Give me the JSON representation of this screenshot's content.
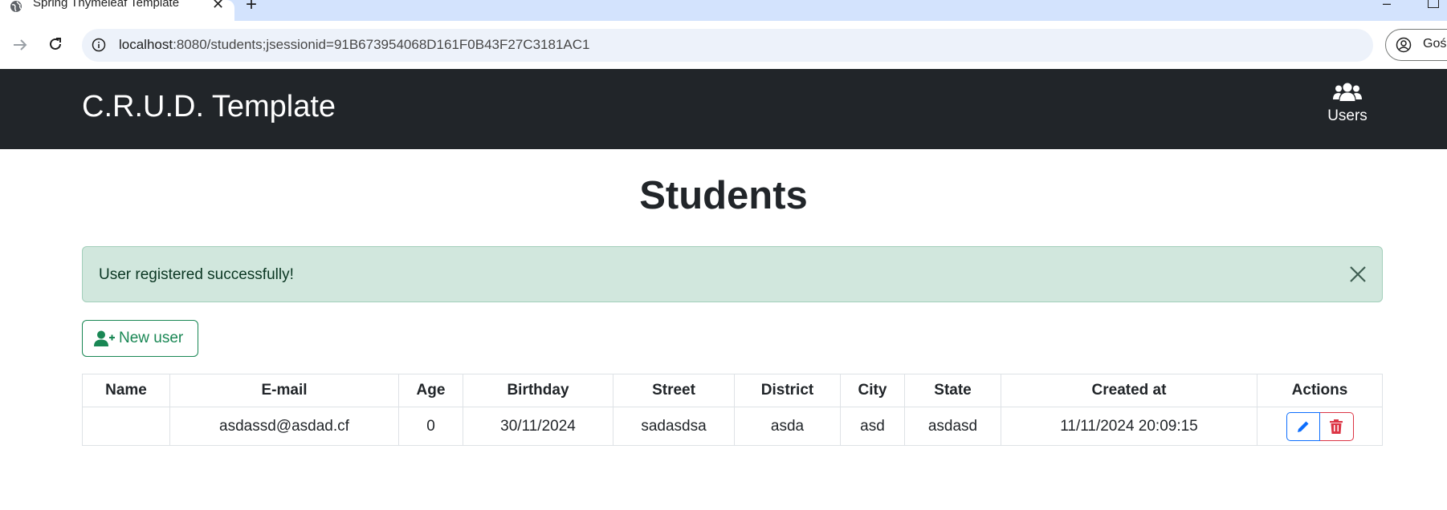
{
  "browser": {
    "tab_title": "Spring Thymeleaf Template",
    "url_host": "localhost",
    "url_path": ":8080/students;jsessionid=91B673954068D161F0B43F27C3181AC1",
    "profile_label": "Gość"
  },
  "navbar": {
    "brand": "C.R.U.D. Template",
    "users_label": "Users"
  },
  "page": {
    "title": "Students",
    "alert_message": "User registered successfully!",
    "new_user_label": "New user"
  },
  "table": {
    "headers": [
      "Name",
      "E-mail",
      "Age",
      "Birthday",
      "Street",
      "District",
      "City",
      "State",
      "Created at",
      "Actions"
    ],
    "rows": [
      {
        "name": "",
        "email": "asdassd@asdad.cf",
        "age": "0",
        "birthday": "30/11/2024",
        "street": "sadasdsa",
        "district": "asda",
        "city": "asd",
        "state": "asdasd",
        "created_at": "11/11/2024 20:09:15"
      }
    ]
  },
  "colors": {
    "navbar_bg": "#212529",
    "alert_bg": "#d1e7dd",
    "success": "#198754",
    "primary": "#0d6efd",
    "danger": "#dc3545"
  },
  "icons": {
    "tab": "globe-icon",
    "users": "users-icon",
    "new_user": "user-plus-icon",
    "edit": "pencil-icon",
    "delete": "trash-icon",
    "alert_close": "close-icon"
  }
}
